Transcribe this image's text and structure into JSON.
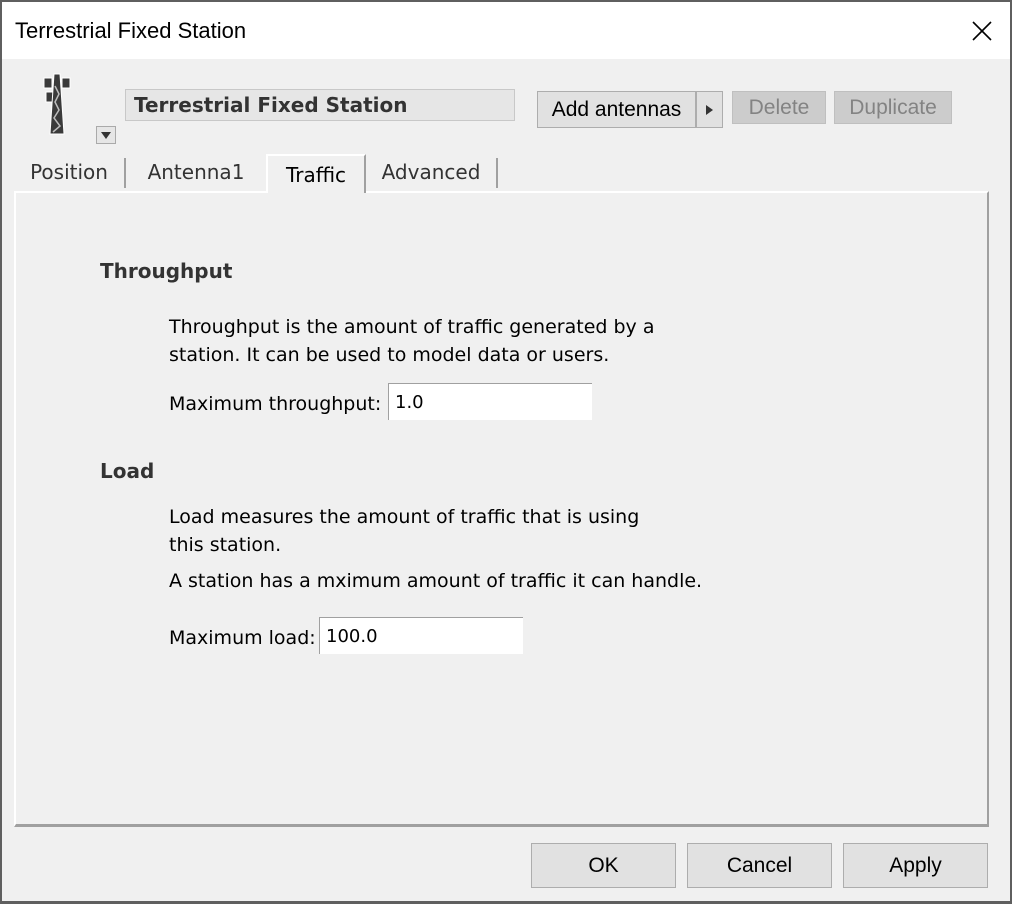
{
  "window": {
    "title": "Terrestrial Fixed Station",
    "close_icon": "close-x-icon"
  },
  "header": {
    "station_icon": "radio-tower-icon",
    "dropdown_icon": "triangle-down-icon",
    "station_name": "Terrestrial Fixed Station",
    "add_antennas_label": "Add antennas",
    "add_antennas_arrow_icon": "triangle-right-icon",
    "delete_label": "Delete",
    "duplicate_label": "Duplicate"
  },
  "tabs": [
    {
      "label": "Position",
      "active": false
    },
    {
      "label": "Antenna1",
      "active": false
    },
    {
      "label": "Traffic",
      "active": true
    },
    {
      "label": "Advanced",
      "active": false
    }
  ],
  "traffic": {
    "throughput": {
      "title": "Throughput",
      "description_line1": "Throughput is the amount of traffic generated by a",
      "description_line2": "station. It can be used to model data or users.",
      "max_label": "Maximum throughput:",
      "max_value": "1.0"
    },
    "load": {
      "title": "Load",
      "description_line1": "Load measures the amount of traffic that is using",
      "description_line2": "this station.",
      "description_line3": "A station has a mximum amount of traffic it can handle.",
      "max_label": "Maximum load:",
      "max_value": "100.0"
    }
  },
  "footer": {
    "ok_label": "OK",
    "cancel_label": "Cancel",
    "apply_label": "Apply"
  }
}
